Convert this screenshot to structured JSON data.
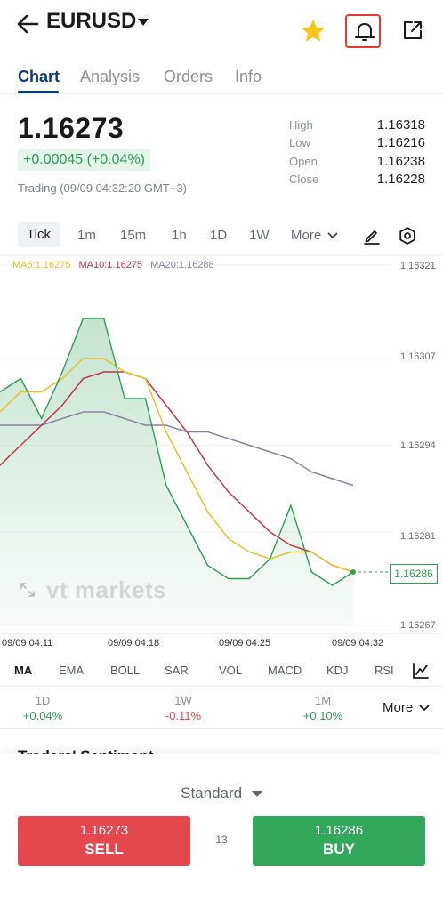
{
  "header": {
    "symbol": "EURUSD",
    "icons": [
      "back-arrow-icon",
      "caret-down-icon",
      "star-icon",
      "bell-icon",
      "share-icon"
    ],
    "star_color": "#f5c518",
    "alert_highlight_color": "#e53935"
  },
  "tabs": [
    {
      "label": "Chart",
      "active": true
    },
    {
      "label": "Analysis"
    },
    {
      "label": "Orders"
    },
    {
      "label": "Info"
    }
  ],
  "quote": {
    "price": "1.16273",
    "change": "+0.00045 (+0.04%)",
    "status": "Trading (09/09 04:32:20 GMT+3)",
    "stats": [
      {
        "label": "High",
        "value": "1.16318"
      },
      {
        "label": "Low",
        "value": "1.16216"
      },
      {
        "label": "Open",
        "value": "1.16238"
      },
      {
        "label": "Close",
        "value": "1.16228"
      }
    ]
  },
  "timeframes": {
    "items": [
      "Tick",
      "1m",
      "15m",
      "1h",
      "1D",
      "1W"
    ],
    "active": "Tick",
    "more_label": "More"
  },
  "chart_data": {
    "type": "area",
    "ma_legend": [
      {
        "label": "MA5:1.16275",
        "color": "#e6c229"
      },
      {
        "label": "MA10:1.16275",
        "color": "#c0364a"
      },
      {
        "label": "MA20:1.16288",
        "color": "#8b7fa5"
      }
    ],
    "y_ticks": [
      "1.16321",
      "1.16307",
      "1.16294",
      "1.16281",
      "1.16267"
    ],
    "ylim": [
      1.16267,
      1.16321
    ],
    "x_ticks": [
      "09/09 04:11",
      "09/09 04:18",
      "09/09 04:25",
      "09/09 04:32"
    ],
    "current_price_tag": "1.16286",
    "watermark": "vt markets",
    "series": [
      {
        "name": "Price",
        "color": "#2e9e55",
        "values": [
          1.16302,
          1.16304,
          1.16298,
          1.16305,
          1.16313,
          1.16313,
          1.16301,
          1.16301,
          1.16288,
          1.16282,
          1.16276,
          1.16274,
          1.16274,
          1.16277,
          1.16285,
          1.16275,
          1.16273,
          1.16275
        ]
      },
      {
        "name": "MA5",
        "color": "#e6c229",
        "values": [
          1.16299,
          1.16302,
          1.16302,
          1.16304,
          1.16307,
          1.16307,
          1.16305,
          1.16304,
          1.16296,
          1.1629,
          1.16284,
          1.1628,
          1.16278,
          1.16277,
          1.16278,
          1.16278,
          1.16276,
          1.16275
        ]
      },
      {
        "name": "MA10",
        "color": "#c0364a",
        "values": [
          1.16291,
          1.16294,
          1.16297,
          1.163,
          1.16304,
          1.16305,
          1.16305,
          1.16304,
          1.163,
          1.16296,
          1.16291,
          1.16287,
          1.16284,
          1.16281,
          1.16279,
          1.16278,
          1.16276,
          1.16275
        ]
      },
      {
        "name": "MA20",
        "color": "#8b7fa5",
        "values": [
          1.16297,
          1.16297,
          1.16297,
          1.16298,
          1.16299,
          1.16299,
          1.16298,
          1.16297,
          1.16297,
          1.16296,
          1.16296,
          1.16295,
          1.16294,
          1.16293,
          1.16292,
          1.1629,
          1.16289,
          1.16288
        ]
      }
    ]
  },
  "indicators": {
    "items": [
      "MA",
      "EMA",
      "BOLL",
      "SAR",
      "VOL",
      "MACD",
      "KDJ",
      "RSI"
    ],
    "active": "MA"
  },
  "performance": {
    "items": [
      {
        "label": "1D",
        "value": "+0.04%",
        "color": "#2e9e55"
      },
      {
        "label": "1W",
        "value": "-0.11%",
        "color": "#e5474f"
      },
      {
        "label": "1M",
        "value": "+0.10%",
        "color": "#2e9e55"
      }
    ],
    "more_label": "More"
  },
  "section_heading": "Traders' Sentiment",
  "trade": {
    "account_type": "Standard",
    "sell": {
      "price": "1.16273",
      "label": "SELL"
    },
    "buy": {
      "price": "1.16286",
      "label": "BUY"
    },
    "spread": "13",
    "sell_color": "#e5474f",
    "buy_color": "#34a85a"
  }
}
